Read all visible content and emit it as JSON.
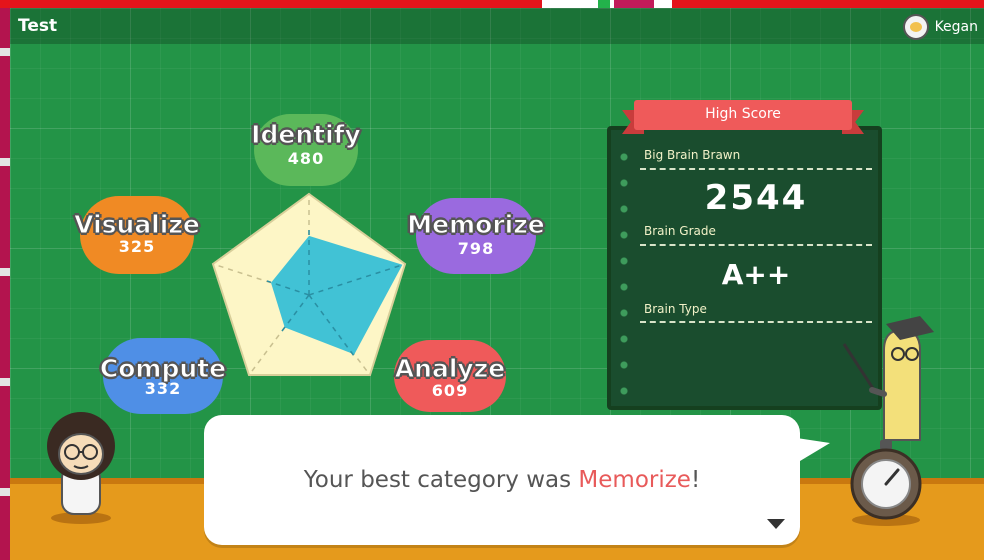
{
  "window": {
    "title": "Test"
  },
  "user": {
    "name": "Kegan"
  },
  "categories": [
    {
      "name": "Identify",
      "score": "480",
      "value": 480,
      "color": "#5bb85a"
    },
    {
      "name": "Memorize",
      "score": "798",
      "value": 798,
      "color": "#9a6adf"
    },
    {
      "name": "Analyze",
      "score": "609",
      "value": 609,
      "color": "#ef5a5a"
    },
    {
      "name": "Compute",
      "score": "332",
      "value": 332,
      "color": "#4f8fe6"
    },
    {
      "name": "Visualize",
      "score": "325",
      "value": 325,
      "color": "#f08a24"
    }
  ],
  "high_score": {
    "header": "High Score",
    "player_label": "Big Brain Brawn",
    "score": "2544",
    "grade_label": "Brain Grade",
    "grade": "A++",
    "type_label": "Brain Type"
  },
  "dialog": {
    "prefix": "Your best category was ",
    "highlight": "Memorize",
    "suffix": "!"
  },
  "colors": {
    "board": "#239447",
    "floor": "#e59a1c",
    "radar_outer": "#fdf6c6",
    "radar_inner": "#37bfd6",
    "panel": "#1a4d2e"
  }
}
